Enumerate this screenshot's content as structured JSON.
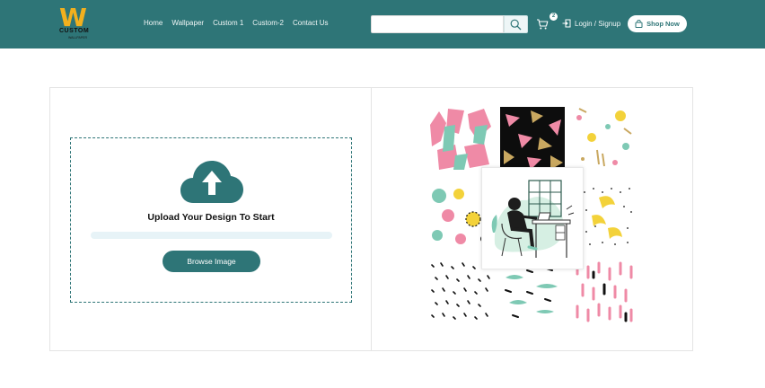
{
  "header": {
    "logo": {
      "mark": "W",
      "name": "CUSTOM",
      "tagline": "WALLPAPER"
    },
    "nav": [
      "Home",
      "Wallpaper",
      "Custom 1",
      "Custom-2",
      "Contact Us"
    ],
    "search": {
      "value": "",
      "placeholder": ""
    },
    "cart_count": "2",
    "login_label": "Login / Signup",
    "shop_now_label": "Shop Now"
  },
  "upload": {
    "title": "Upload Your Design To Start",
    "progress_percent": 0,
    "browse_label": "Browse Image"
  },
  "colors": {
    "primary": "#2e7577",
    "pink": "#ef8aa6",
    "yellow": "#f3d23a",
    "mint": "#7ec9b4",
    "gold": "#c9a860"
  },
  "icons": [
    "search-icon",
    "cart-icon",
    "login-icon",
    "bag-icon",
    "upload-cloud-icon"
  ]
}
